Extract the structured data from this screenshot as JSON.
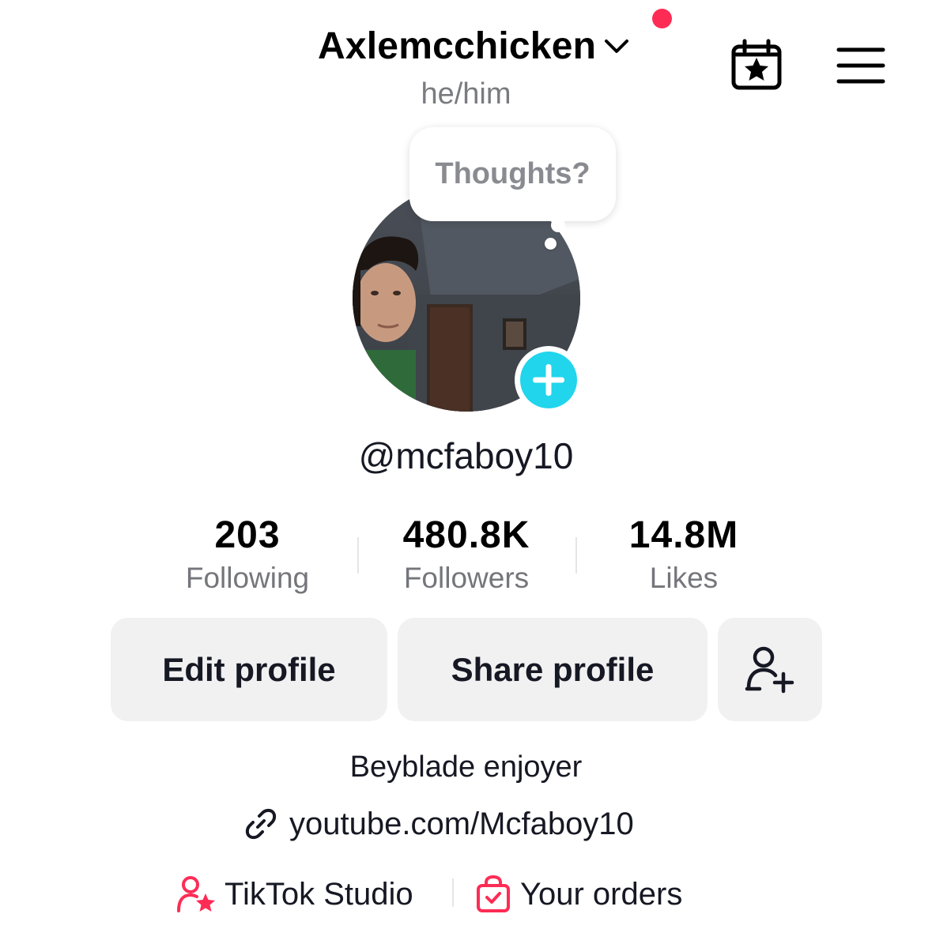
{
  "header": {
    "username": "Axlemcchicken",
    "pronouns": "he/him",
    "icons": {
      "dropdown": "chevron-down-icon",
      "calendar": "calendar-star-icon",
      "menu": "hamburger-menu-icon"
    },
    "notification_color": "#fe2c55"
  },
  "profile": {
    "bubble_text": "Thoughts?",
    "handle": "@mcfaboy10",
    "add_badge_color": "#20d5ec"
  },
  "stats": [
    {
      "value": "203",
      "label": "Following"
    },
    {
      "value": "480.8K",
      "label": "Followers"
    },
    {
      "value": "14.8M",
      "label": "Likes"
    }
  ],
  "buttons": {
    "edit": "Edit profile",
    "share": "Share profile",
    "add_friend_icon": "add-friend-icon"
  },
  "bio": {
    "text": "Beyblade enjoyer",
    "link": "youtube.com/Mcfaboy10"
  },
  "shortcuts": [
    {
      "label": "TikTok Studio",
      "icon": "tiktok-studio-icon",
      "color": "#fe2c55"
    },
    {
      "label": "Your orders",
      "icon": "shopping-bag-icon",
      "color": "#fe2c55"
    }
  ]
}
